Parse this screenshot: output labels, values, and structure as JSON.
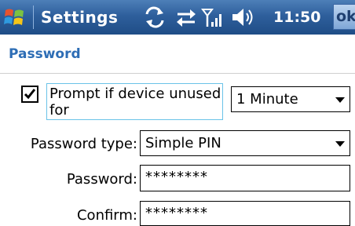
{
  "titlebar": {
    "app_title": "Settings",
    "time": "11:50",
    "ok_label": "ok",
    "icons": [
      "windows-start-icon",
      "sync-icon",
      "connectivity-icon",
      "signal-icon",
      "volume-icon"
    ]
  },
  "page": {
    "title": "Password"
  },
  "form": {
    "prompt_checkbox_checked": true,
    "prompt_label": "Prompt if device unused for",
    "timeout_value": "1 Minute",
    "password_type_label": "Password type:",
    "password_type_value": "Simple PIN",
    "password_label": "Password:",
    "password_value": "********",
    "confirm_label": "Confirm:",
    "confirm_value": "********"
  },
  "colors": {
    "titlebar": "#2e5f9c",
    "header_text": "#2d6db5",
    "focus_border": "#6ac3e8"
  }
}
